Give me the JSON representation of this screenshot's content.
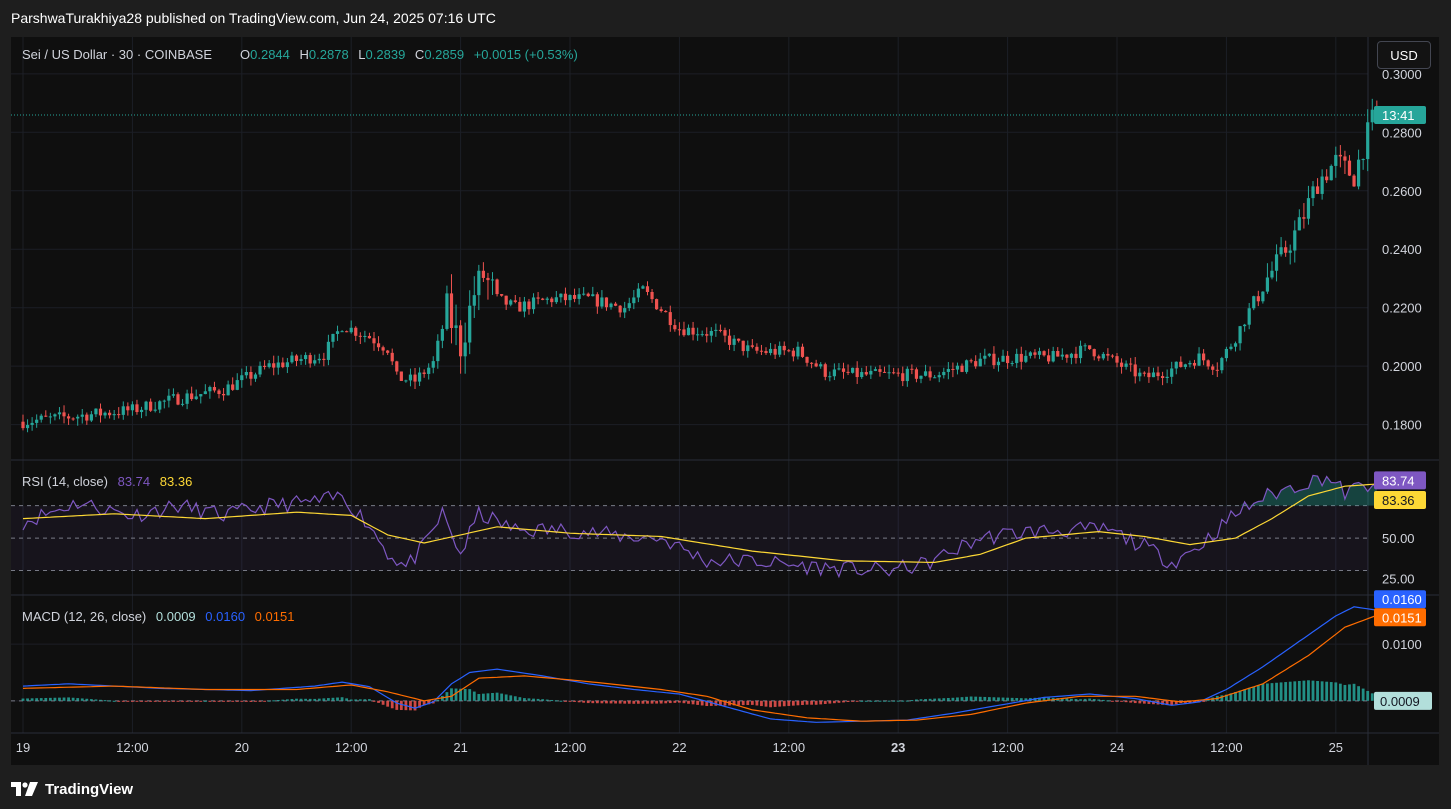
{
  "header": {
    "published": "ParshwaTurakhiya28 published on TradingView.com, Jun 24, 2025 07:16 UTC"
  },
  "symbol": {
    "name": "Sei / US Dollar · 30 · COINBASE",
    "o_label": "O",
    "o": "0.2844",
    "h_label": "H",
    "h": "0.2878",
    "l_label": "L",
    "l": "0.2839",
    "c_label": "C",
    "c": "0.2859",
    "change": "+0.0015 (+0.53%)"
  },
  "currency_button": "USD",
  "price_axis": {
    "ticks": [
      "0.3000",
      "0.2800",
      "0.2600",
      "0.2400",
      "0.2200",
      "0.2000",
      "0.1800"
    ],
    "countdown": "13:41"
  },
  "rsi": {
    "label": "RSI (14, close)",
    "value": "83.74",
    "ma_value": "83.36",
    "ticks": [
      "50.00",
      "25.00"
    ]
  },
  "macd": {
    "label": "MACD (12, 26, close)",
    "hist": "0.0009",
    "macd": "0.0160",
    "signal": "0.0151",
    "ticks": [
      "0.0100"
    ]
  },
  "time_axis": [
    "19",
    "12:00",
    "20",
    "12:00",
    "21",
    "12:00",
    "22",
    "12:00",
    "23",
    "12:00",
    "24",
    "12:00",
    "25"
  ],
  "footer": {
    "brand": "TradingView"
  },
  "colors": {
    "up": "#26a69a",
    "down": "#ef5350",
    "rsi": "#7e57c2",
    "rsi_ma": "#fdd835",
    "macd": "#2962ff",
    "signal": "#ff6d00",
    "hist_up": "#b2dfdb",
    "hist_down": "#ffcdd2",
    "price_line": "#26a69a"
  },
  "chart_data": [
    {
      "type": "candlestick",
      "title": "Sei / US Dollar · 30 · COINBASE",
      "x_ticks": [
        "19",
        "12:00",
        "20",
        "12:00",
        "21",
        "12:00",
        "22",
        "12:00",
        "23",
        "12:00",
        "24",
        "12:00",
        "25"
      ],
      "ylim": [
        0.172,
        0.302
      ],
      "y_ticks": [
        0.3,
        0.28,
        0.26,
        0.24,
        0.22,
        0.2,
        0.18
      ],
      "last_close": 0.2859,
      "bars_per_day": 48,
      "close_path_anchors": [
        [
          0,
          0.181
        ],
        [
          12,
          0.183
        ],
        [
          24,
          0.185
        ],
        [
          34,
          0.189
        ],
        [
          44,
          0.192
        ],
        [
          54,
          0.2
        ],
        [
          66,
          0.204
        ],
        [
          70,
          0.214
        ],
        [
          76,
          0.21
        ],
        [
          80,
          0.206
        ],
        [
          82,
          0.196
        ],
        [
          86,
          0.195
        ],
        [
          90,
          0.201
        ],
        [
          93,
          0.219
        ],
        [
          96,
          0.207
        ],
        [
          99,
          0.225
        ],
        [
          101,
          0.231
        ],
        [
          104,
          0.223
        ],
        [
          108,
          0.22
        ],
        [
          116,
          0.223
        ],
        [
          124,
          0.223
        ],
        [
          132,
          0.22
        ],
        [
          136,
          0.226
        ],
        [
          144,
          0.213
        ],
        [
          152,
          0.211
        ],
        [
          160,
          0.205
        ],
        [
          170,
          0.205
        ],
        [
          176,
          0.198
        ],
        [
          184,
          0.197
        ],
        [
          192,
          0.197
        ],
        [
          200,
          0.197
        ],
        [
          210,
          0.202
        ],
        [
          218,
          0.203
        ],
        [
          226,
          0.203
        ],
        [
          234,
          0.206
        ],
        [
          240,
          0.201
        ],
        [
          246,
          0.196
        ],
        [
          252,
          0.199
        ],
        [
          258,
          0.203
        ],
        [
          262,
          0.2
        ],
        [
          266,
          0.21
        ],
        [
          272,
          0.228
        ],
        [
          276,
          0.237
        ],
        [
          280,
          0.248
        ],
        [
          284,
          0.263
        ],
        [
          288,
          0.27
        ],
        [
          292,
          0.265
        ],
        [
          294,
          0.275
        ],
        [
          296,
          0.284
        ],
        [
          297,
          0.2859
        ]
      ]
    },
    {
      "type": "line",
      "title": "RSI (14, close)",
      "ylim": [
        18,
        92
      ],
      "levels": [
        70,
        50,
        30
      ],
      "y_ticks": [
        50,
        25
      ],
      "series": [
        {
          "name": "RSI",
          "last": 83.74,
          "anchors": [
            [
              0,
              60
            ],
            [
              12,
              72
            ],
            [
              24,
              64
            ],
            [
              34,
              70
            ],
            [
              44,
              64
            ],
            [
              54,
              70
            ],
            [
              66,
              73
            ],
            [
              70,
              76
            ],
            [
              76,
              58
            ],
            [
              80,
              41
            ],
            [
              84,
              32
            ],
            [
              88,
              45
            ],
            [
              92,
              65
            ],
            [
              96,
              40
            ],
            [
              100,
              65
            ],
            [
              108,
              55
            ],
            [
              120,
              55
            ],
            [
              132,
              51
            ],
            [
              140,
              50
            ],
            [
              150,
              36
            ],
            [
              160,
              36
            ],
            [
              170,
              33
            ],
            [
              180,
              31
            ],
            [
              190,
              30
            ],
            [
              198,
              34
            ],
            [
              210,
              50
            ],
            [
              220,
              54
            ],
            [
              230,
              55
            ],
            [
              238,
              55
            ],
            [
              246,
              45
            ],
            [
              252,
              35
            ],
            [
              258,
              45
            ],
            [
              262,
              55
            ],
            [
              266,
              65
            ],
            [
              272,
              75
            ],
            [
              280,
              83
            ],
            [
              286,
              88
            ],
            [
              290,
              78
            ],
            [
              294,
              82
            ],
            [
              297,
              83.74
            ]
          ]
        },
        {
          "name": "RSI-based MA",
          "last": 83.36,
          "anchors": [
            [
              0,
              62
            ],
            [
              20,
              65
            ],
            [
              40,
              62
            ],
            [
              60,
              66
            ],
            [
              72,
              64
            ],
            [
              80,
              52
            ],
            [
              88,
              47
            ],
            [
              96,
              52
            ],
            [
              104,
              57
            ],
            [
              120,
              53
            ],
            [
              140,
              51
            ],
            [
              160,
              42
            ],
            [
              180,
              36
            ],
            [
              200,
              35
            ],
            [
              210,
              40
            ],
            [
              220,
              50
            ],
            [
              236,
              54
            ],
            [
              246,
              51
            ],
            [
              256,
              46
            ],
            [
              266,
              50
            ],
            [
              274,
              62
            ],
            [
              282,
              76
            ],
            [
              290,
              82
            ],
            [
              297,
              83.36
            ]
          ]
        }
      ]
    },
    {
      "type": "line",
      "title": "MACD (12, 26, close)",
      "ylim": [
        -0.0048,
        0.0178
      ],
      "y_ticks": [
        0.01
      ],
      "series": [
        {
          "name": "MACD",
          "last": 0.016,
          "anchors": [
            [
              0,
              0.0026
            ],
            [
              10,
              0.003
            ],
            [
              30,
              0.0022
            ],
            [
              50,
              0.0018
            ],
            [
              64,
              0.0026
            ],
            [
              70,
              0.0033
            ],
            [
              76,
              0.0025
            ],
            [
              82,
              -0.0004
            ],
            [
              86,
              -0.0013
            ],
            [
              90,
              -0.0002
            ],
            [
              94,
              0.003
            ],
            [
              98,
              0.005
            ],
            [
              104,
              0.0056
            ],
            [
              114,
              0.0044
            ],
            [
              124,
              0.003
            ],
            [
              134,
              0.002
            ],
            [
              144,
              0.0012
            ],
            [
              154,
              -0.001
            ],
            [
              164,
              -0.0032
            ],
            [
              174,
              -0.0038
            ],
            [
              184,
              -0.0036
            ],
            [
              194,
              -0.0034
            ],
            [
              204,
              -0.0022
            ],
            [
              214,
              -0.0008
            ],
            [
              224,
              0.0006
            ],
            [
              234,
              0.0012
            ],
            [
              244,
              0.0004
            ],
            [
              252,
              -0.0008
            ],
            [
              258,
              -0.0002
            ],
            [
              264,
              0.002
            ],
            [
              272,
              0.006
            ],
            [
              280,
              0.0105
            ],
            [
              288,
              0.015
            ],
            [
              292,
              0.0166
            ],
            [
              297,
              0.016
            ]
          ]
        },
        {
          "name": "Signal",
          "last": 0.0151,
          "anchors": [
            [
              0,
              0.0022
            ],
            [
              20,
              0.0026
            ],
            [
              40,
              0.002
            ],
            [
              60,
              0.002
            ],
            [
              72,
              0.0028
            ],
            [
              80,
              0.0016
            ],
            [
              88,
              0.0
            ],
            [
              94,
              0.0008
            ],
            [
              100,
              0.004
            ],
            [
              110,
              0.0044
            ],
            [
              124,
              0.0034
            ],
            [
              140,
              0.002
            ],
            [
              150,
              0.0008
            ],
            [
              160,
              -0.0016
            ],
            [
              172,
              -0.003
            ],
            [
              184,
              -0.0036
            ],
            [
              196,
              -0.0034
            ],
            [
              208,
              -0.0024
            ],
            [
              220,
              -0.0004
            ],
            [
              232,
              0.0008
            ],
            [
              244,
              0.0008
            ],
            [
              254,
              -0.0002
            ],
            [
              262,
              0.0004
            ],
            [
              272,
              0.003
            ],
            [
              282,
              0.008
            ],
            [
              290,
              0.013
            ],
            [
              297,
              0.0151
            ]
          ]
        },
        {
          "name": "Histogram",
          "last": 0.0009
        }
      ]
    }
  ]
}
